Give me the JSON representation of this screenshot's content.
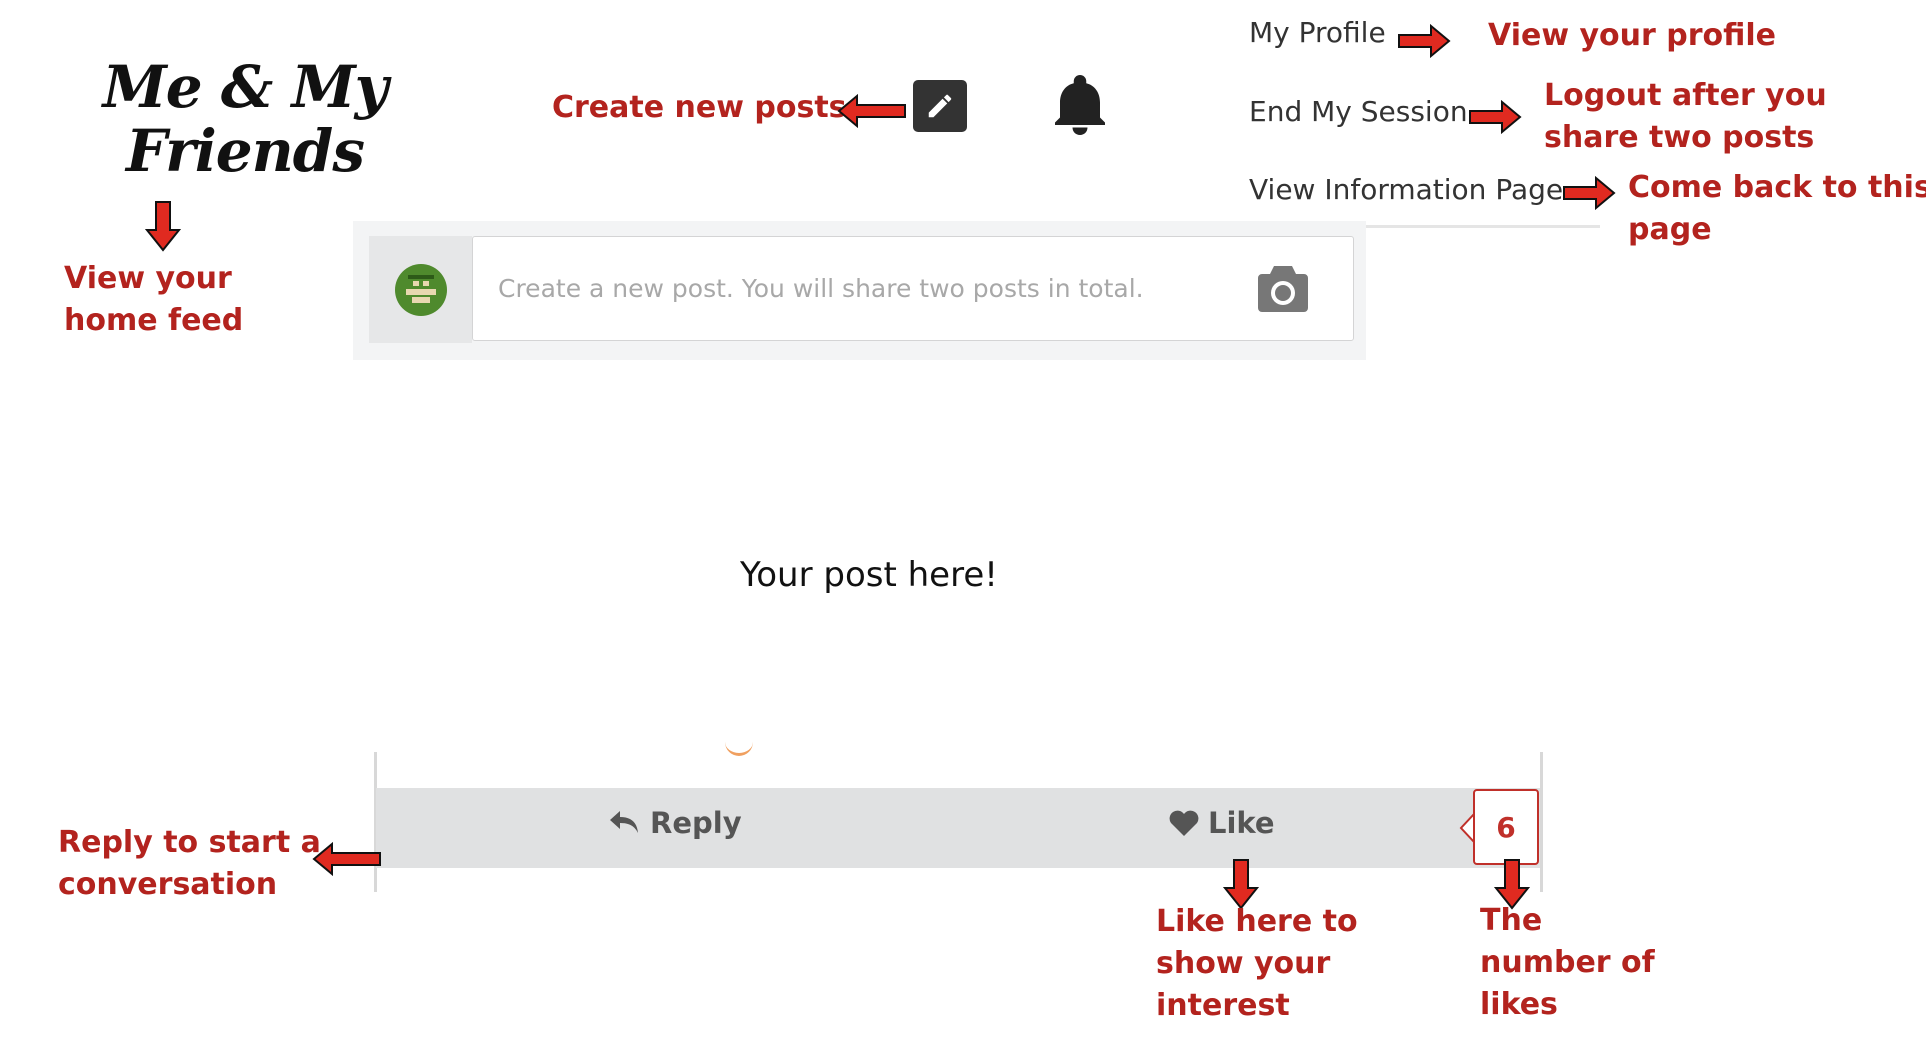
{
  "logo": {
    "line1": "Me & My",
    "line2": "Friends"
  },
  "menu": {
    "profile": "My Profile",
    "end_session": "End My Session",
    "info_page": "View Information Page"
  },
  "compose": {
    "placeholder": "Create a new post. You will share two posts in total."
  },
  "post": {
    "text": "Your post here!"
  },
  "actions": {
    "reply": "Reply",
    "like": "Like",
    "like_count": "6"
  },
  "annotations": {
    "home_feed": [
      "View your",
      "home feed"
    ],
    "create_posts": "Create new posts",
    "view_profile": "View your profile",
    "logout": [
      "Logout after you",
      "share two posts"
    ],
    "come_back": [
      "Come back to this",
      "page"
    ],
    "reply": [
      "Reply to start a",
      "conversation"
    ],
    "like": [
      "Like here to",
      "show your",
      "interest"
    ],
    "likes_count": [
      "The",
      "number of",
      "likes"
    ]
  },
  "colors": {
    "annotation_red": "#b3231e",
    "arrow_red": "#e02a20",
    "avatar_green": "#4f8a2d",
    "action_bar": "#e0e1e2"
  },
  "icons": {
    "compose": "pencil-icon",
    "notifications": "bell-icon",
    "camera": "camera-icon",
    "reply": "reply-arrow-icon",
    "like": "heart-icon"
  }
}
